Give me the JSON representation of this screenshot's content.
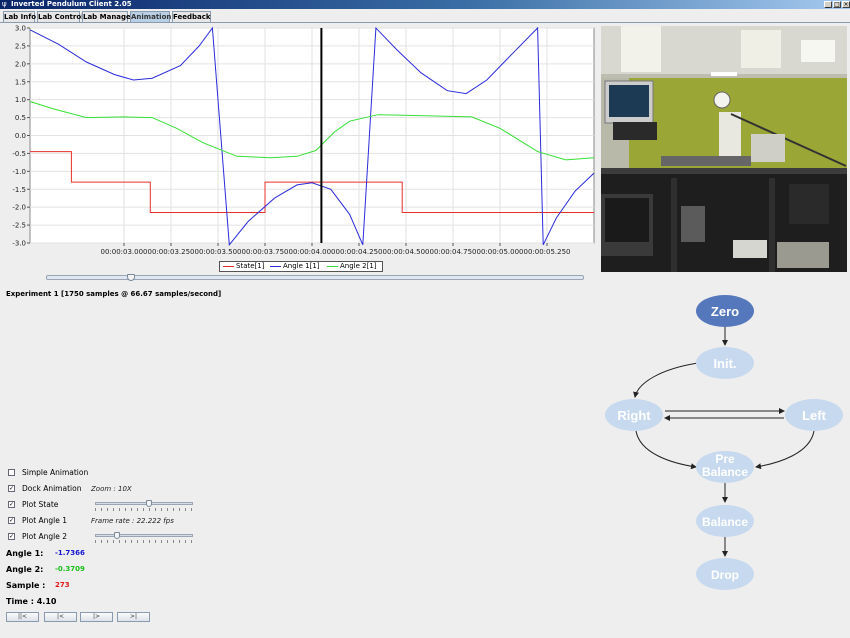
{
  "window": {
    "title": "Inverted Pendulum Client 2.05"
  },
  "tabs": [
    {
      "label": "Lab Info"
    },
    {
      "label": "Lab Control"
    },
    {
      "label": "Lab Manage"
    },
    {
      "label": "Animation",
      "active": true
    },
    {
      "label": "Feedback"
    }
  ],
  "chart_data": {
    "type": "line",
    "xlabel": "",
    "ylabel": "",
    "ylim": [
      -3.0,
      3.0
    ],
    "yticks": [
      "3.0",
      "2.5",
      "2.0",
      "1.5",
      "1.0",
      "0.5",
      "0.0",
      "-0.5",
      "-1.0",
      "-1.5",
      "-2.0",
      "-2.5",
      "-3.0"
    ],
    "xlim": [
      2.5,
      5.5
    ],
    "xticks": [
      {
        "x": 3.0,
        "label": "00:00:03.000"
      },
      {
        "x": 3.25,
        "label": "00:00:03.250"
      },
      {
        "x": 3.5,
        "label": "00:00:03.500"
      },
      {
        "x": 3.75,
        "label": "00:00:03.750"
      },
      {
        "x": 4.0,
        "label": "00:00:04.000"
      },
      {
        "x": 4.25,
        "label": "00:00:04.250"
      },
      {
        "x": 4.5,
        "label": "00:00:04.500"
      },
      {
        "x": 4.75,
        "label": "00:00:04.750"
      },
      {
        "x": 5.0,
        "label": "00:00:05.000"
      },
      {
        "x": 5.25,
        "label": "00:00:05.250"
      }
    ],
    "cursor_x": 4.05,
    "grid": true,
    "legend_position": "bottom-center",
    "series": [
      {
        "name": "State[1]",
        "color": "#e8302a",
        "points": [
          [
            2.5,
            -0.45
          ],
          [
            2.72,
            -0.45
          ],
          [
            2.72,
            -1.3
          ],
          [
            3.14,
            -1.3
          ],
          [
            3.14,
            -2.15
          ],
          [
            3.75,
            -2.15
          ],
          [
            3.75,
            -1.3
          ],
          [
            4.48,
            -1.3
          ],
          [
            4.48,
            -2.15
          ],
          [
            5.5,
            -2.15
          ]
        ]
      },
      {
        "name": "Angle 1[1]",
        "color": "#2b2bdc",
        "points": [
          [
            2.5,
            2.95
          ],
          [
            2.65,
            2.55
          ],
          [
            2.8,
            2.05
          ],
          [
            2.95,
            1.7
          ],
          [
            3.05,
            1.55
          ],
          [
            3.15,
            1.6
          ],
          [
            3.3,
            1.95
          ],
          [
            3.4,
            2.5
          ],
          [
            3.47,
            3.0
          ],
          [
            3.56,
            -3.05
          ],
          [
            3.66,
            -2.4
          ],
          [
            3.8,
            -1.75
          ],
          [
            3.92,
            -1.38
          ],
          [
            4.0,
            -1.32
          ],
          [
            4.1,
            -1.5
          ],
          [
            4.2,
            -2.2
          ],
          [
            4.27,
            -3.05
          ],
          [
            4.34,
            3.0
          ],
          [
            4.45,
            2.4
          ],
          [
            4.58,
            1.75
          ],
          [
            4.72,
            1.25
          ],
          [
            4.82,
            1.17
          ],
          [
            4.93,
            1.55
          ],
          [
            5.05,
            2.2
          ],
          [
            5.2,
            3.0
          ],
          [
            5.23,
            -3.05
          ],
          [
            5.3,
            -2.3
          ],
          [
            5.4,
            -1.55
          ],
          [
            5.5,
            -1.05
          ]
        ]
      },
      {
        "name": "Angle 2[1]",
        "color": "#35e035",
        "points": [
          [
            2.5,
            0.95
          ],
          [
            2.62,
            0.75
          ],
          [
            2.8,
            0.5
          ],
          [
            3.0,
            0.52
          ],
          [
            3.15,
            0.5
          ],
          [
            3.28,
            0.2
          ],
          [
            3.42,
            -0.2
          ],
          [
            3.6,
            -0.58
          ],
          [
            3.78,
            -0.62
          ],
          [
            3.92,
            -0.58
          ],
          [
            4.02,
            -0.42
          ],
          [
            4.12,
            0.1
          ],
          [
            4.2,
            0.4
          ],
          [
            4.35,
            0.58
          ],
          [
            4.6,
            0.55
          ],
          [
            4.85,
            0.52
          ],
          [
            5.0,
            0.2
          ],
          [
            5.2,
            -0.45
          ],
          [
            5.35,
            -0.68
          ],
          [
            5.5,
            -0.62
          ]
        ]
      }
    ]
  },
  "timeline": {
    "position": 0.15
  },
  "experiment_info": "Experiment 1 [1750 samples @ 66.67 samples/second]",
  "options": [
    {
      "label": "Simple Animation",
      "checked": false
    },
    {
      "label": "Dock Animation",
      "checked": true
    },
    {
      "label": "Plot State",
      "checked": true
    },
    {
      "label": "Plot Angle 1",
      "checked": true
    },
    {
      "label": "Plot Angle 2",
      "checked": true
    }
  ],
  "zoom": {
    "text": "Zoom : 10X",
    "level": 0.55
  },
  "frame_rate": {
    "text": "Frame rate : 22.222 fps",
    "level": 0.2
  },
  "readouts": {
    "angle1_label": "Angle 1:",
    "angle1_value": "-1.7366",
    "angle1_color": "#1414d0",
    "angle2_label": "Angle 2:",
    "angle2_value": "-0.3709",
    "angle2_color": "#18c018",
    "sample_label": "Sample :",
    "sample_value": "273",
    "sample_color": "#e01818",
    "time_label": "Time : 4.10"
  },
  "playback_buttons": [
    {
      "label": "||<",
      "icon": "rewind-start-icon"
    },
    {
      "label": "|<",
      "icon": "step-back-icon"
    },
    {
      "label": "|>",
      "icon": "play-icon"
    },
    {
      "label": ">|",
      "icon": "skip-end-icon"
    }
  ],
  "state_diagram": {
    "nodes": [
      {
        "id": "zero",
        "label": "Zero",
        "active": true
      },
      {
        "id": "init",
        "label": "Init."
      },
      {
        "id": "right",
        "label": "Right"
      },
      {
        "id": "left",
        "label": "Left"
      },
      {
        "id": "prebalance",
        "label_line1": "Pre",
        "label_line2": "Balance"
      },
      {
        "id": "balance",
        "label": "Balance"
      },
      {
        "id": "drop",
        "label": "Drop"
      }
    ],
    "colors": {
      "active": "#5577bb",
      "inactive": "#c7d9ef",
      "active_text": "#ffffff",
      "inactive_text": "#ffffff"
    }
  }
}
